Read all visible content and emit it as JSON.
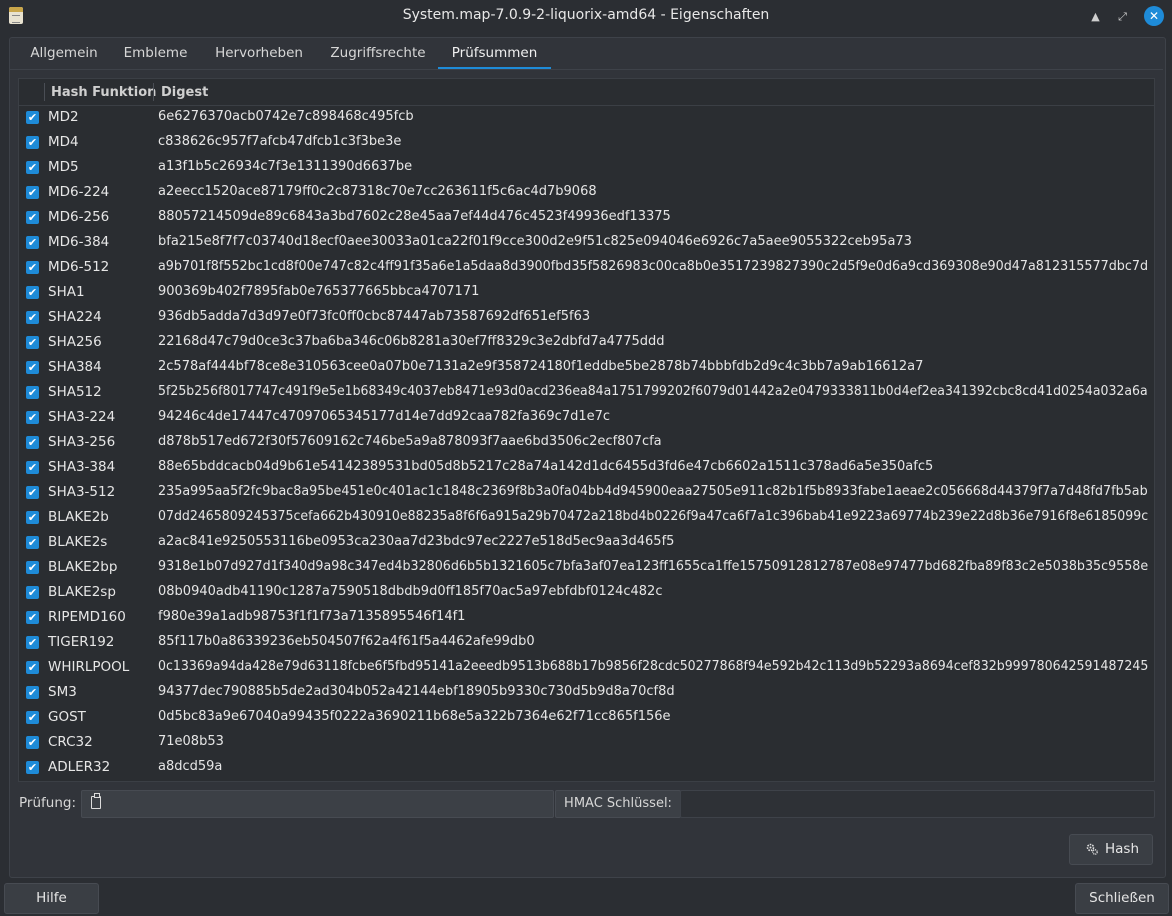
{
  "window": {
    "title": "System.map-7.0.9-2-liquorix-amd64 - Eigenschaften",
    "icon": "document-icon",
    "controls": [
      "minimize-icon",
      "maximize-icon",
      "close-icon"
    ]
  },
  "tabs": [
    {
      "label": "Allgemein",
      "active": false
    },
    {
      "label": "Embleme",
      "active": false
    },
    {
      "label": "Hervorheben",
      "active": false
    },
    {
      "label": "Zugriffsrechte",
      "active": false
    },
    {
      "label": "Prüfsummen",
      "active": true
    }
  ],
  "table": {
    "headers": {
      "name": "Hash Funktion",
      "digest": "Digest"
    },
    "rows": [
      {
        "name": "MD2",
        "digest": "6e6276370acb0742e7c898468c495fcb",
        "checked": true
      },
      {
        "name": "MD4",
        "digest": "c838626c957f7afcb47dfcb1c3f3be3e",
        "checked": true
      },
      {
        "name": "MD5",
        "digest": "a13f1b5c26934c7f3e1311390d6637be",
        "checked": true
      },
      {
        "name": "MD6-224",
        "digest": "a2eecc1520ace87179ff0c2c87318c70e7cc263611f5c6ac4d7b9068",
        "checked": true
      },
      {
        "name": "MD6-256",
        "digest": "88057214509de89c6843a3bd7602c28e45aa7ef44d476c4523f49936edf13375",
        "checked": true
      },
      {
        "name": "MD6-384",
        "digest": "bfa215e8f7f7c03740d18ecf0aee30033a01ca22f01f9cce300d2e9f51c825e094046e6926c7a5aee9055322ceb95a73",
        "checked": true
      },
      {
        "name": "MD6-512",
        "digest": "a9b701f8f552bc1cd8f00e747c82c4ff91f35a6e1a5daa8d3900fbd35f5826983c00ca8b0e3517239827390c2d5f9e0d6a9cd369308e90d47a812315577dbc7d",
        "checked": true
      },
      {
        "name": "SHA1",
        "digest": "900369b402f7895fab0e765377665bbca4707171",
        "checked": true
      },
      {
        "name": "SHA224",
        "digest": "936db5adda7d3d97e0f73fc0ff0cbc87447ab73587692df651ef5f63",
        "checked": true
      },
      {
        "name": "SHA256",
        "digest": "22168d47c79d0ce3c37ba6ba346c06b8281a30ef7ff8329c3e2dbfd7a4775ddd",
        "checked": true
      },
      {
        "name": "SHA384",
        "digest": "2c578af444bf78ce8e310563cee0a07b0e7131a2e9f358724180f1eddbe5be2878b74bbbfdb2d9c4c3bb7a9ab16612a7",
        "checked": true
      },
      {
        "name": "SHA512",
        "digest": "5f25b256f8017747c491f9e5e1b68349c4037eb8471e93d0acd236ea84a1751799202f6079d01442a2e0479333811b0d4ef2ea341392cbc8cd41d0254a032a6a",
        "checked": true
      },
      {
        "name": "SHA3-224",
        "digest": "94246c4de17447c47097065345177d14e7dd92caa782fa369c7d1e7c",
        "checked": true
      },
      {
        "name": "SHA3-256",
        "digest": "d878b517ed672f30f57609162c746be5a9a878093f7aae6bd3506c2ecf807cfa",
        "checked": true
      },
      {
        "name": "SHA3-384",
        "digest": "88e65bddcacb04d9b61e54142389531bd05d8b5217c28a74a142d1dc6455d3fd6e47cb6602a1511c378ad6a5e350afc5",
        "checked": true
      },
      {
        "name": "SHA3-512",
        "digest": "235a995aa5f2fc9bac8a95be451e0c401ac1c1848c2369f8b3a0fa04bb4d945900eaa27505e911c82b1f5b8933fabe1aeae2c056668d44379f7a7d48fd7fb5ab",
        "checked": true
      },
      {
        "name": "BLAKE2b",
        "digest": "07dd2465809245375cefa662b430910e88235a8f6f6a915a29b70472a218bd4b0226f9a47ca6f7a1c396bab41e9223a69774b239e22d8b36e7916f8e6185099c",
        "checked": true
      },
      {
        "name": "BLAKE2s",
        "digest": "a2ac841e9250553116be0953ca230aa7d23bdc97ec2227e518d5ec9aa3d465f5",
        "checked": true
      },
      {
        "name": "BLAKE2bp",
        "digest": "9318e1b07d927d1f340d9a98c347ed4b32806d6b5b1321605c7bfa3af07ea123ff1655ca1ffe15750912812787e08e97477bd682fba89f83c2e5038b35c9558e",
        "checked": true
      },
      {
        "name": "BLAKE2sp",
        "digest": "08b0940adb41190c1287a7590518dbdb9d0ff185f70ac5a97ebfdbf0124c482c",
        "checked": true
      },
      {
        "name": "RIPEMD160",
        "digest": "f980e39a1adb98753f1f1f73a7135895546f14f1",
        "checked": true
      },
      {
        "name": "TIGER192",
        "digest": "85f117b0a86339236eb504507f62a4f61f5a4462afe99db0",
        "checked": true
      },
      {
        "name": "WHIRLPOOL",
        "digest": "0c13369a94da428e79d63118fcbe6f5fbd95141a2eeedb9513b688b17b9856f28cdc50277868f94e592b42c113d9b52293a8694cef832b999780642591487245",
        "checked": true
      },
      {
        "name": "SM3",
        "digest": "94377dec790885b5de2ad304b052a42144ebf18905b9330c730d5b9d8a70cf8d",
        "checked": true
      },
      {
        "name": "GOST",
        "digest": "0d5bc83a9e67040a99435f0222a3690211b68e5a322b7364e62f71cc865f156e",
        "checked": true
      },
      {
        "name": "CRC32",
        "digest": "71e08b53",
        "checked": true
      },
      {
        "name": "ADLER32",
        "digest": "a8dcd59a",
        "checked": true
      }
    ]
  },
  "check": {
    "label": "Prüfung:",
    "value": "",
    "icon": "clipboard-icon"
  },
  "hmac": {
    "label": "HMAC Schlüssel:",
    "value": ""
  },
  "buttons": {
    "hash": "Hash",
    "help": "Hilfe",
    "close": "Schließen"
  },
  "colors": {
    "accent": "#1e8bd8",
    "background": "#2b2e33",
    "list_bg": "#2a2d31"
  }
}
